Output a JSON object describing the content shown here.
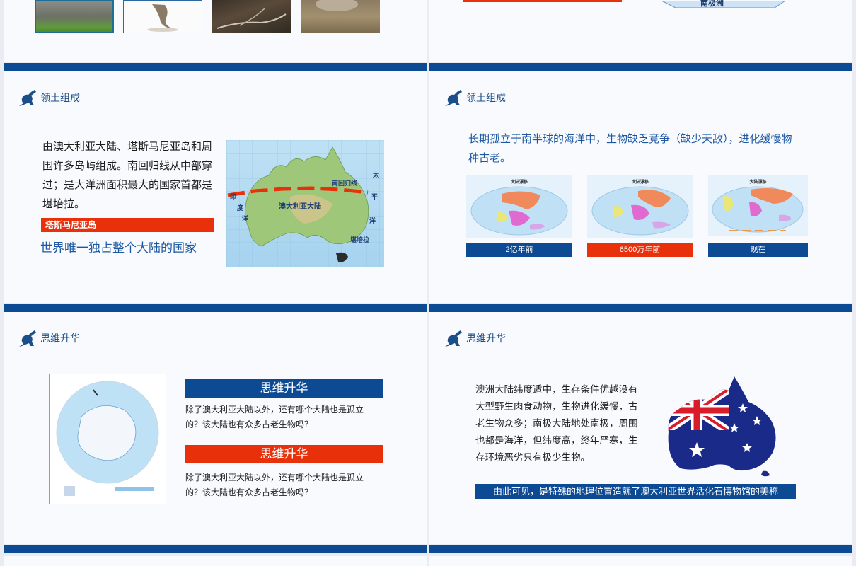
{
  "colors": {
    "navy": "#0c4a93",
    "red": "#e8300a",
    "text": "#1d1d1d",
    "accent_blue": "#1b57a3"
  },
  "top_left": {
    "photos": [
      "koala-photo",
      "kangaroo-photo",
      "lyrebird-photo",
      "sheep-photo"
    ]
  },
  "top_right": {
    "map_label": "南极洲"
  },
  "slide_a": {
    "header": "领土组成",
    "paragraph": "由澳大利亚大陆、塔斯马尼亚岛和周围许多岛屿组成。南回归线从中部穿过；是大洋洲面积最大的国家首都是堪培拉。",
    "red_label": "塔斯马尼亚岛",
    "highlight": "世界唯一独占整个大陆的国家",
    "map_labels": {
      "tropic": "南回归线",
      "continent": "澳大利亚大陆",
      "capital": "堪培拉",
      "ocean_east_1": "太",
      "ocean_east_2": "平",
      "ocean_east_3": "洋",
      "ocean_west_1": "印",
      "ocean_west_2": "度",
      "ocean_west_3": "洋"
    }
  },
  "slide_b": {
    "header": "领土组成",
    "heading": "长期孤立于南半球的海洋中，生物缺乏竞争（缺少天敌），进化缓慢物种古老。",
    "maps": [
      {
        "title": "大陆漂移",
        "caption": "2亿年前",
        "caption_color": "#0c4a93"
      },
      {
        "title": "大陆漂移",
        "caption": "6500万年前",
        "caption_color": "#e8300a"
      },
      {
        "title": "大陆漂移",
        "caption": "现在",
        "caption_color": "#0c4a93"
      }
    ]
  },
  "slide_c": {
    "header": "思维升华",
    "box1_title": "思维升华",
    "box1_text": "除了澳大利亚大陆以外，还有哪个大陆也是孤立的？该大陆也有众多古老生物吗？",
    "box2_title": "思维升华",
    "box2_text": "除了澳大利亚大陆以外，还有哪个大陆也是孤立的？该大陆也有众多古老生物吗？"
  },
  "slide_d": {
    "header": "思维升华",
    "paragraph": "澳洲大陆纬度适中，生存条件优越没有大型野生肉食动物，生物进化缓慢，古老生物众多；南极大陆地处南极，周围也都是海洋，但纬度高，终年严寒，生存环境恶劣只有极少生物。",
    "conclusion": "由此可见，是特殊的地理位置造就了澳大利亚世界活化石博物馆的美称"
  }
}
